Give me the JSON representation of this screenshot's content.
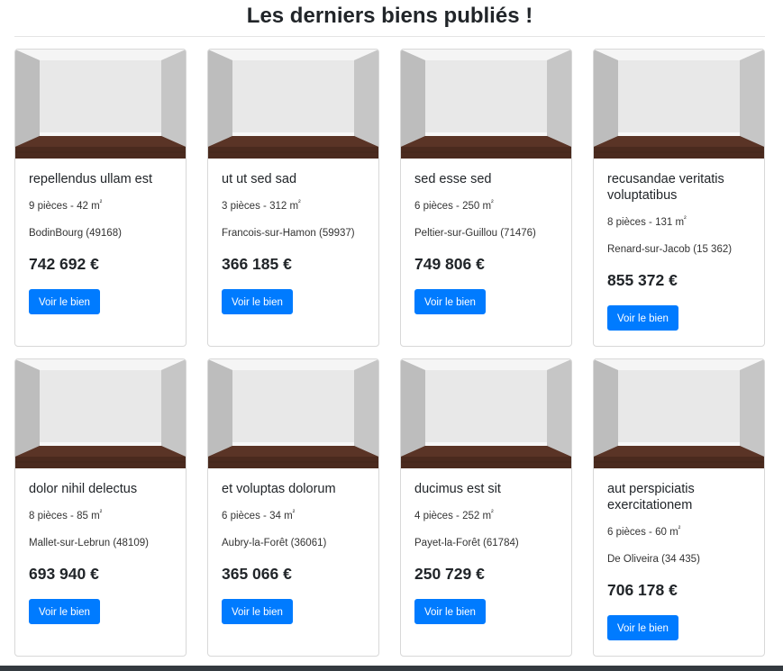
{
  "page": {
    "title": "Les derniers biens publiés !"
  },
  "colors": {
    "primary": "#007bff",
    "footer": "#343a40"
  },
  "listings": [
    {
      "title": "repellendus ullam est",
      "rooms": "9 pièces",
      "area": "42 m",
      "sup": "²",
      "city": "BodinBourg (49168)",
      "price": "742 692 €",
      "button": "Voir le bien"
    },
    {
      "title": "ut ut sed sad",
      "rooms": "3 pièces",
      "area": "312 m",
      "sup": "²",
      "city": "Francois-sur-Hamon (59937)",
      "price": "366 185 €",
      "button": "Voir le bien"
    },
    {
      "title": "sed esse sed",
      "rooms": "6 pièces",
      "area": "250 m",
      "sup": "²",
      "city": "Peltier-sur-Guillou (71476)",
      "price": "749 806 €",
      "button": "Voir le bien"
    },
    {
      "title": "recusandae veritatis voluptatibus",
      "rooms": "8 pièces",
      "area": "131 m",
      "sup": "²",
      "city": "Renard-sur-Jacob (15 362)",
      "price": "855 372 €",
      "button": "Voir le bien"
    },
    {
      "title": "dolor nihil delectus",
      "rooms": "8 pièces",
      "area": "85 m",
      "sup": "²",
      "city": "Mallet-sur-Lebrun (48109)",
      "price": "693 940 €",
      "button": "Voir le bien"
    },
    {
      "title": "et voluptas dolorum",
      "rooms": "6 pièces",
      "area": "34 m",
      "sup": "²",
      "city": "Aubry-la-Forêt (36061)",
      "price": "365 066 €",
      "button": "Voir le bien"
    },
    {
      "title": "ducimus est sit",
      "rooms": "4 pièces",
      "area": "252 m",
      "sup": "²",
      "city": "Payet-la-Forêt (61784)",
      "price": "250 729 €",
      "button": "Voir le bien"
    },
    {
      "title": "aut perspiciatis exercitationem",
      "rooms": "6 pièces",
      "area": "60 m",
      "sup": "²",
      "city": "De Oliveira (34 435)",
      "price": "706 178 €",
      "button": "Voir le bien"
    }
  ]
}
